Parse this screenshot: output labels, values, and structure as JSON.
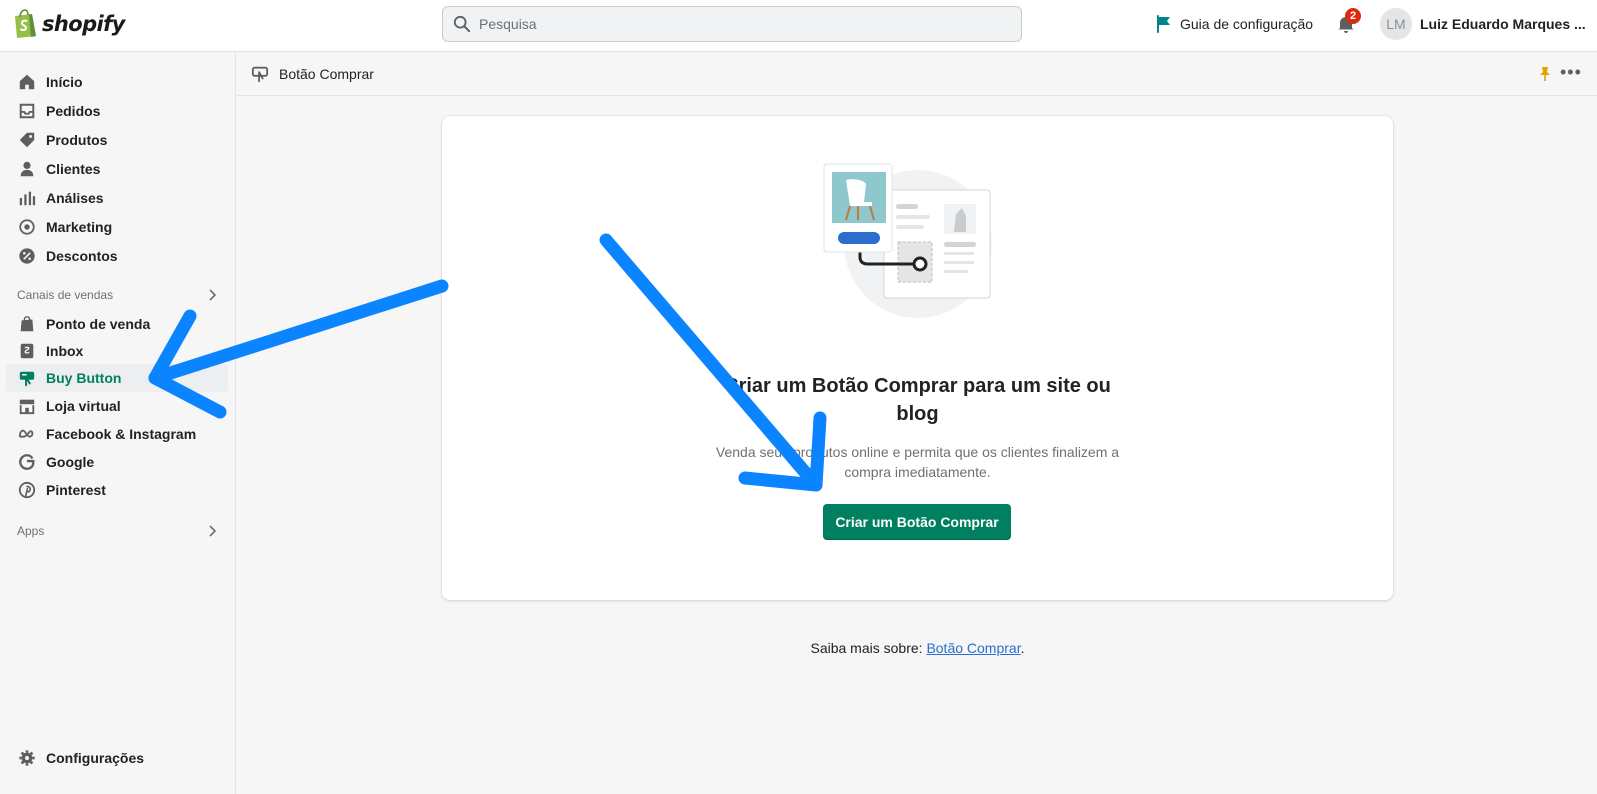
{
  "brand": {
    "name": "shopify"
  },
  "search": {
    "placeholder": "Pesquisa"
  },
  "topbar": {
    "setup_guide": "Guia de configuração",
    "notifications_count": "2",
    "user_initials": "LM",
    "user_name": "Luiz Eduardo Marques ..."
  },
  "sidebar": {
    "main": [
      {
        "label": "Início",
        "icon": "home-icon"
      },
      {
        "label": "Pedidos",
        "icon": "orders-icon"
      },
      {
        "label": "Produtos",
        "icon": "tag-icon"
      },
      {
        "label": "Clientes",
        "icon": "person-icon"
      },
      {
        "label": "Análises",
        "icon": "bar-chart-icon"
      },
      {
        "label": "Marketing",
        "icon": "target-icon"
      },
      {
        "label": "Descontos",
        "icon": "discount-icon"
      }
    ],
    "sales_channels_label": "Canais de vendas",
    "channels": [
      {
        "label": "Ponto de venda",
        "icon": "pos-icon"
      },
      {
        "label": "Inbox",
        "icon": "inbox-icon"
      },
      {
        "label": "Buy Button",
        "icon": "buy-button-icon",
        "active": true
      },
      {
        "label": "Loja virtual",
        "icon": "store-icon"
      },
      {
        "label": "Facebook & Instagram",
        "icon": "meta-icon"
      },
      {
        "label": "Google",
        "icon": "google-icon"
      },
      {
        "label": "Pinterest",
        "icon": "pinterest-icon"
      }
    ],
    "apps_label": "Apps",
    "settings_label": "Configurações"
  },
  "page": {
    "title": "Botão Comprar"
  },
  "card": {
    "title": "Criar um Botão Comprar para um site ou blog",
    "description": "Venda seus produtos online e permita que os clientes finalizem a compra imediatamente.",
    "primary_action": "Criar um Botão Comprar"
  },
  "footer": {
    "prefix": "Saiba mais sobre: ",
    "link": "Botão Comprar",
    "suffix": "."
  },
  "colors": {
    "accent": "#008060",
    "annotation_arrow": "#0a84ff",
    "badge": "#d82c0d",
    "link": "#2c6ecb"
  }
}
